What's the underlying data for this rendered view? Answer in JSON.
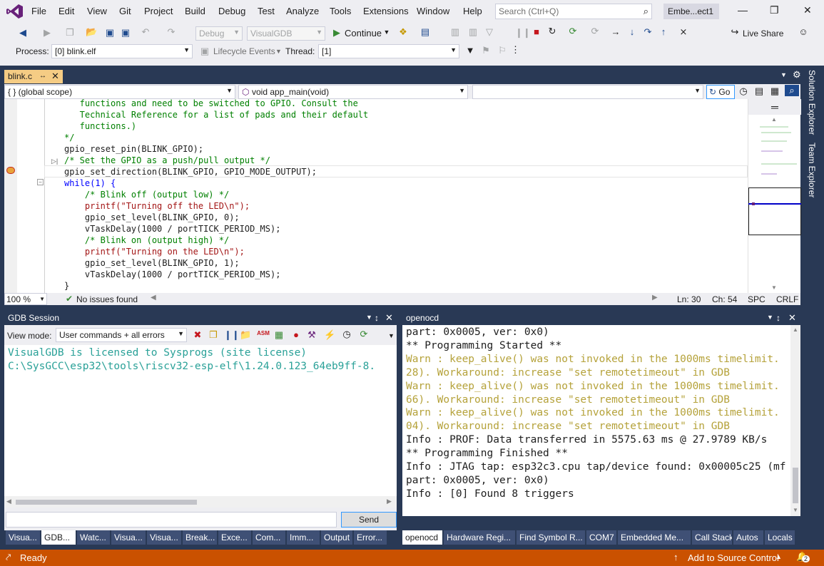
{
  "menu": [
    "File",
    "Edit",
    "View",
    "Git",
    "Project",
    "Build",
    "Debug",
    "Test",
    "Analyze",
    "Tools",
    "Extensions",
    "Window",
    "Help"
  ],
  "search": {
    "placeholder": "Search (Ctrl+Q)"
  },
  "solution_name": "Embe...ect1",
  "toolbar": {
    "config": "Debug",
    "platform": "VisualGDB",
    "continue_label": "Continue",
    "live_share": "Live Share"
  },
  "debug_location": {
    "process_label": "Process:",
    "process_value": "[0] blink.elf",
    "lifecycle_label": "Lifecycle Events",
    "thread_label": "Thread:",
    "thread_value": "[1]"
  },
  "right_rail": [
    "Solution Explorer",
    "Team Explorer"
  ],
  "doc_tab": {
    "name": "blink.c"
  },
  "nav": {
    "scope": "{ } (global scope)",
    "function": "void app_main(void)",
    "go_label": "Go"
  },
  "code_lines": [
    "   functions and need to be switched to GPIO. Consult the",
    "   Technical Reference for a list of pads and their default",
    "   functions.)",
    "*/",
    "gpio_reset_pin(BLINK_GPIO);",
    "/* Set the GPIO as a push/pull output */",
    "gpio_set_direction(BLINK_GPIO, GPIO_MODE_OUTPUT);",
    "while(1) {",
    "    /* Blink off (output low) */",
    "    printf(\"Turning off the LED\\n\");",
    "    gpio_set_level(BLINK_GPIO, 0);",
    "    vTaskDelay(1000 / portTICK_PERIOD_MS);",
    "    /* Blink on (output high) */",
    "    printf(\"Turning on the LED\\n\");",
    "    gpio_set_level(BLINK_GPIO, 1);",
    "    vTaskDelay(1000 / portTICK_PERIOD_MS);",
    "}"
  ],
  "editor_status": {
    "zoom": "100 %",
    "issues": "No issues found",
    "ln": "Ln: 30",
    "ch": "Ch: 54",
    "spc": "SPC",
    "crlf": "CRLF"
  },
  "gdb": {
    "title": "GDB Session",
    "view_mode_label": "View mode:",
    "view_mode_value": "User commands + all errors",
    "output": [
      "VisualGDB is licensed to Sysprogs (site license)",
      "C:\\SysGCC\\esp32\\tools\\riscv32-esp-elf\\1.24.0.123_64eb9ff-8."
    ],
    "send_label": "Send"
  },
  "openocd": {
    "title": "openocd",
    "lines": [
      {
        "text": "part: 0x0005, ver: 0x0)",
        "kind": "info"
      },
      {
        "text": "** Programming Started **",
        "kind": "info"
      },
      {
        "text": "Warn : keep_alive() was not invoked in the 1000ms timelimit.",
        "kind": "warn"
      },
      {
        "text": "28). Workaround: increase \"set remotetimeout\" in GDB",
        "kind": "warn"
      },
      {
        "text": "Warn : keep_alive() was not invoked in the 1000ms timelimit.",
        "kind": "warn"
      },
      {
        "text": "66). Workaround: increase \"set remotetimeout\" in GDB",
        "kind": "warn"
      },
      {
        "text": "Warn : keep_alive() was not invoked in the 1000ms timelimit.",
        "kind": "warn"
      },
      {
        "text": "04). Workaround: increase \"set remotetimeout\" in GDB",
        "kind": "warn"
      },
      {
        "text": "Info : PROF: Data transferred in 5575.63 ms @ 27.9789 KB/s",
        "kind": "info"
      },
      {
        "text": "** Programming Finished **",
        "kind": "info"
      },
      {
        "text": "Info : JTAG tap: esp32c3.cpu tap/device found: 0x00005c25 (mf",
        "kind": "info"
      },
      {
        "text": "part: 0x0005, ver: 0x0)",
        "kind": "info"
      },
      {
        "text": "Info : [0] Found 8 triggers",
        "kind": "info"
      }
    ]
  },
  "left_tabs": [
    "Visua...",
    "GDB...",
    "Watc...",
    "Visua...",
    "Visua...",
    "Break...",
    "Exce...",
    "Com...",
    "Imm...",
    "Output",
    "Error..."
  ],
  "right_tabs": [
    "openocd",
    "Hardware Regi...",
    "Find Symbol R...",
    "COM7",
    "Embedded Me...",
    "Call Stack",
    "Autos",
    "Locals"
  ],
  "status": {
    "ready": "Ready",
    "source_control": "Add to Source Control",
    "notifications": "2"
  },
  "colors": {
    "accent": "#ca5100",
    "tab_active": "#f5cc84",
    "frame": "#293955",
    "warn": "#b5a23a",
    "gdb_text": "#2aa198"
  }
}
